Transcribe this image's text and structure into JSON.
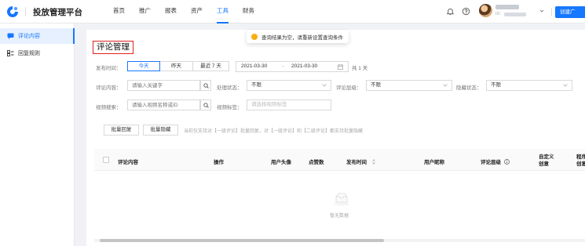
{
  "header": {
    "app_title": "投放管理平台",
    "nav": [
      "首页",
      "推广",
      "报表",
      "资产",
      "工具",
      "财务"
    ],
    "active_nav": "工具",
    "user": {
      "id_label": "ID:"
    },
    "create_button": "创建广"
  },
  "sidebar": {
    "items": [
      {
        "label": "评论内容",
        "icon": "comment-icon",
        "active": true
      },
      {
        "label": "回复规则",
        "icon": "rule-icon",
        "active": false
      }
    ]
  },
  "toast": {
    "text": "查询结果为空，请重新设置查询条件",
    "icon": "warning-icon"
  },
  "page": {
    "title": "评论管理"
  },
  "filters": {
    "publish_time_label": "发布时间：",
    "time_options": [
      "今天",
      "昨天",
      "最近 7 天"
    ],
    "active_time_option": "今天",
    "date_start": "2021-03-30",
    "date_sep": "→",
    "date_end": "2021-03-30",
    "date_span": "共 1 天",
    "comment_content_label": "评论内容：",
    "comment_placeholder": "请输入关键字",
    "process_status_label": "处理状态：",
    "process_status_value": "不限",
    "comment_level_label": "评论层级：",
    "comment_level_value": "不限",
    "hidden_status_label": "隐藏状态：",
    "hidden_status_value": "不限",
    "video_search_label": "视频搜索：",
    "video_search_placeholder": "请输入视频名称或ID",
    "video_tag_label": "视频标签：",
    "video_tag_placeholder": "请选择视频标签"
  },
  "actions": {
    "batch_reply": "批量回复",
    "batch_hide": "批量隐藏",
    "hint": "当前仅支持对【一级评论】批量回复，对【一级评论】和【二级评论】都支持批量隐藏"
  },
  "table": {
    "columns": [
      "评论内容",
      "操作",
      "用户头像",
      "点赞数",
      "发布时间",
      "用户昵称",
      "评论层级",
      "自定义创意",
      "程序化创意"
    ],
    "empty_text": "暂无数据"
  },
  "colors": {
    "primary": "#1677ff",
    "highlight_box": "#e02020",
    "warning": "#faad14"
  }
}
